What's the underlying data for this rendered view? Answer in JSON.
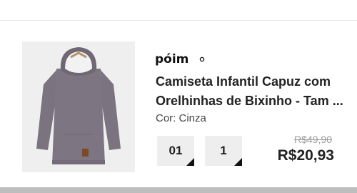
{
  "product": {
    "brand": "PÓIM",
    "title_line1": "Camiseta Infantil Capuz com",
    "title_line2": "Orelhinhas de Bixinho - Tam ...",
    "color_label": "Cor: Cinza",
    "size_value": "01",
    "quantity_value": "1",
    "old_price": "R$49,90",
    "price": "R$20,93"
  },
  "colors": {
    "garment": "#7b7480",
    "hood_lining": "#f2f2f2",
    "price_text": "#222222",
    "old_price_text": "#9a9a9a"
  },
  "icons": {
    "size_dropdown": "corner-triangle-icon",
    "quantity_dropdown": "corner-triangle-icon"
  }
}
